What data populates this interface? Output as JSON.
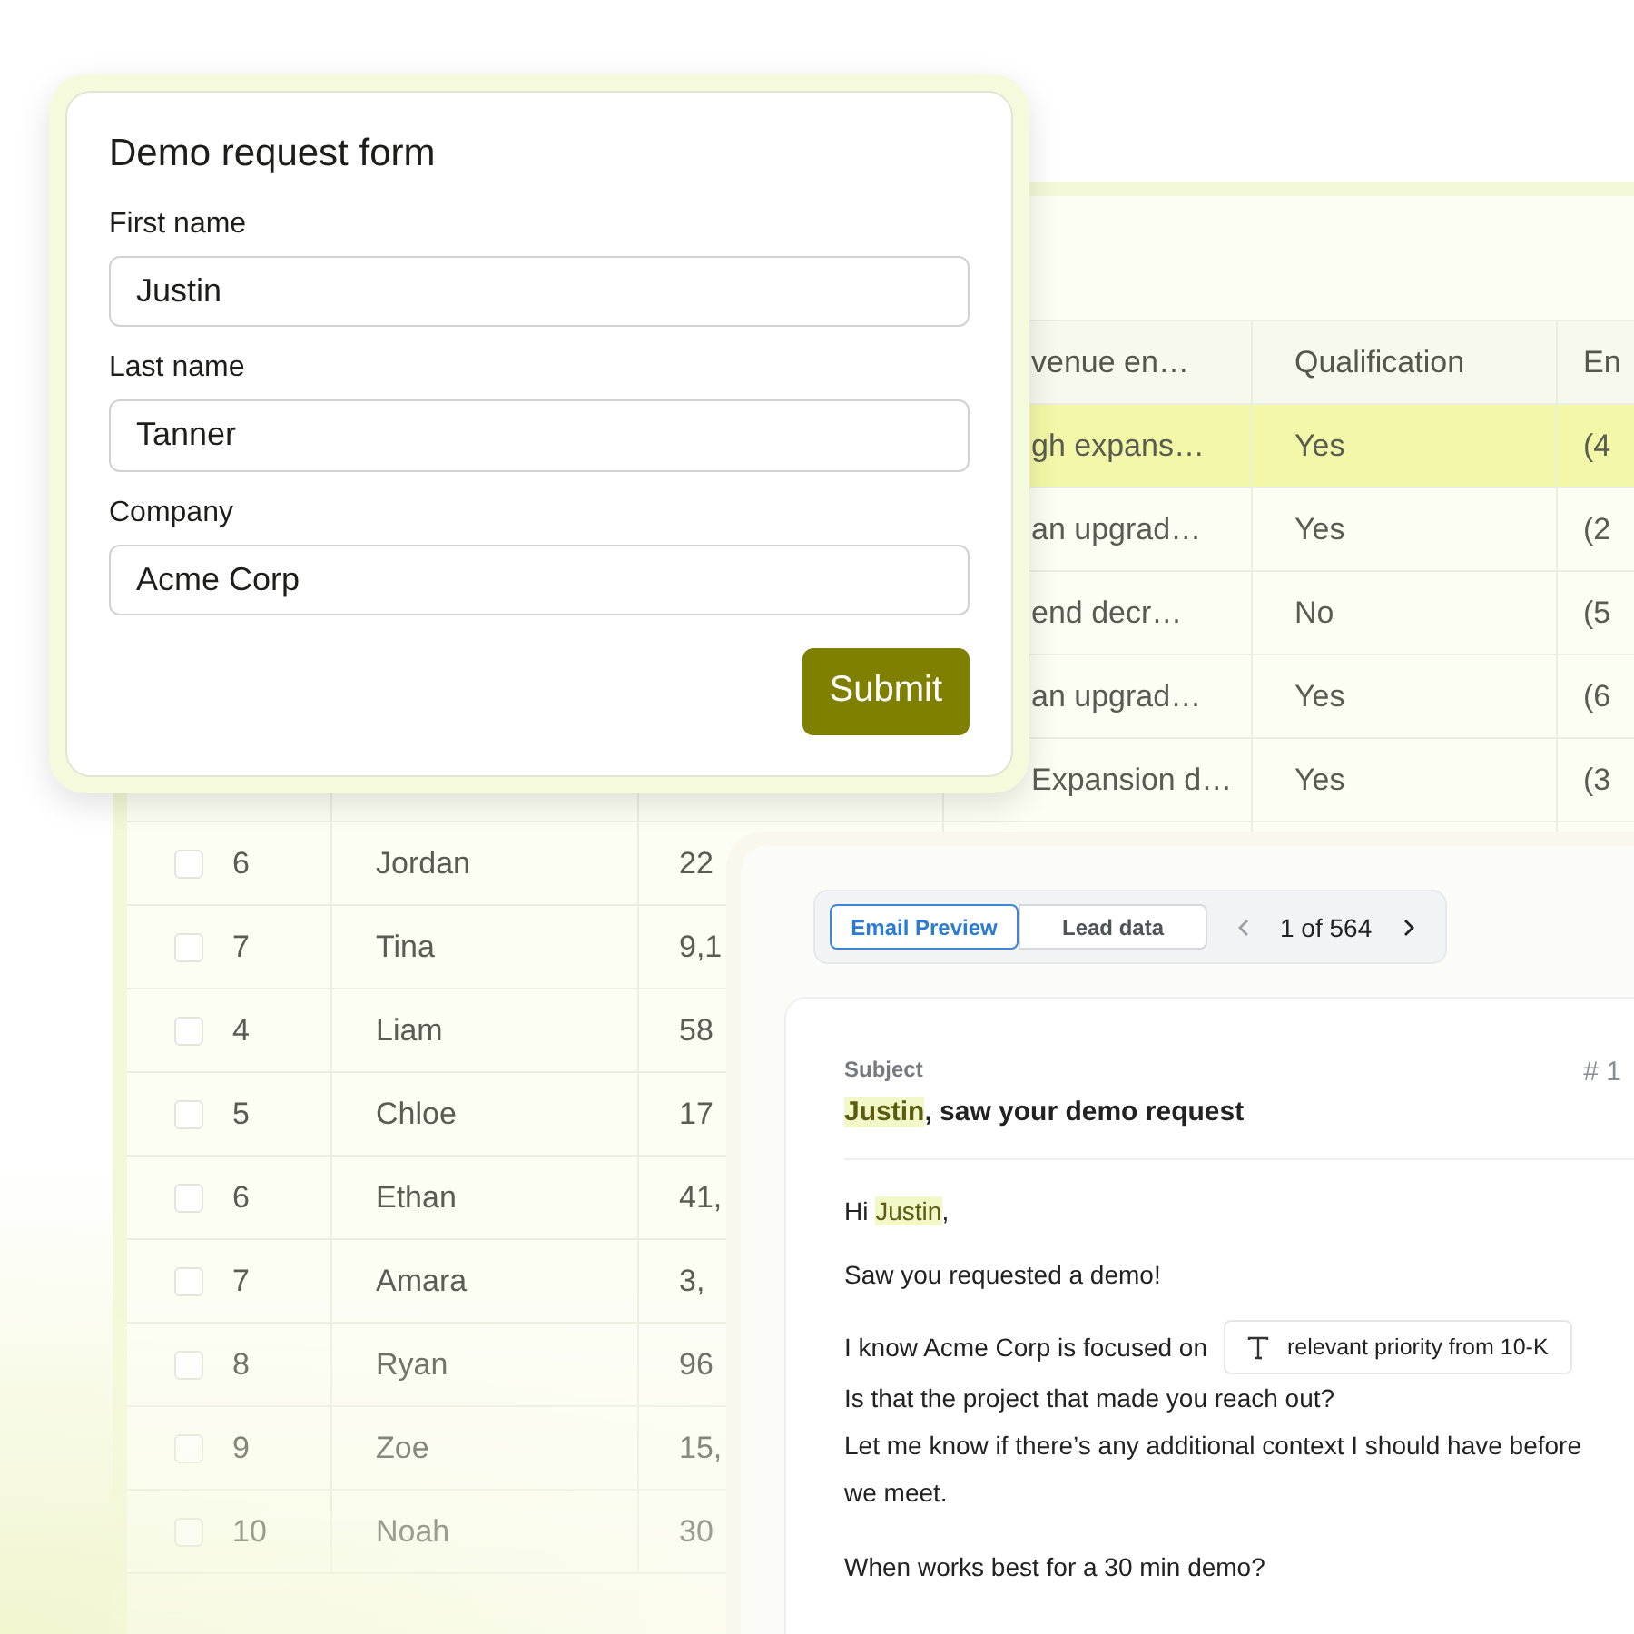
{
  "table": {
    "columns": [
      {
        "label": "venue en…"
      },
      {
        "label": "Qualification"
      },
      {
        "label": "En"
      }
    ],
    "rows": [
      {
        "selected": true,
        "revenue": "gh expans…",
        "qualification": "Yes",
        "column_6": "(4"
      },
      {
        "selected": false,
        "revenue": "an upgrad…",
        "qualification": "Yes",
        "column_6": "(2"
      },
      {
        "selected": false,
        "revenue": "end decr…",
        "qualification": "No",
        "column_6": "(5"
      },
      {
        "selected": false,
        "revenue": "an upgrad…",
        "qualification": "Yes",
        "column_6": "(6"
      },
      {
        "selected": false,
        "revenue": "Expansion d…",
        "qualification": "Yes",
        "column_6": "(3"
      },
      {
        "selected": false,
        "checked": false,
        "index": "6",
        "name": "Jordan",
        "amount": "22"
      },
      {
        "selected": false,
        "checked": false,
        "index": "7",
        "name": "Tina",
        "amount": "9,1"
      },
      {
        "selected": false,
        "checked": false,
        "index": "4",
        "name": "Liam",
        "amount": "58"
      },
      {
        "selected": false,
        "checked": false,
        "index": "5",
        "name": "Chloe",
        "amount": "17"
      },
      {
        "selected": false,
        "checked": false,
        "index": "6",
        "name": "Ethan",
        "amount": "41,"
      },
      {
        "selected": false,
        "checked": false,
        "index": "7",
        "name": "Amara",
        "amount": "3,"
      },
      {
        "selected": false,
        "checked": false,
        "index": "8",
        "name": "Ryan",
        "amount": "96"
      },
      {
        "selected": false,
        "checked": false,
        "index": "9",
        "name": "Zoe",
        "amount": "15,"
      },
      {
        "selected": false,
        "checked": false,
        "index": "10",
        "name": "Noah",
        "amount": "30"
      }
    ]
  },
  "form": {
    "title": "Demo request form",
    "fields": [
      {
        "label": "First name",
        "value": "Justin"
      },
      {
        "label": "Last name",
        "value": "Tanner"
      },
      {
        "label": "Company",
        "value": "Acme Corp"
      }
    ],
    "submit": "Submit"
  },
  "email": {
    "tabs": [
      {
        "label": "Email Preview",
        "selected": true
      },
      {
        "label": "Lead data",
        "selected": false
      }
    ],
    "pager": "1 of 564",
    "subject_label": "Subject",
    "subject": {
      "highlight": "Justin",
      "rest": ", saw your demo request"
    },
    "counter": "# 1",
    "greeting": {
      "before": "Hi ",
      "highlight": "Justin",
      "after": ","
    },
    "intro": "Saw you requested a demo!",
    "focus_text": "I know Acme Corp is focused on",
    "variable_chip": "relevant priority from 10-K",
    "lines": [
      "Is that the project that made you reach out?",
      "Let me know if there’s any additional context I should have before we meet."
    ],
    "closing": "When works best for a 30 min demo?"
  }
}
